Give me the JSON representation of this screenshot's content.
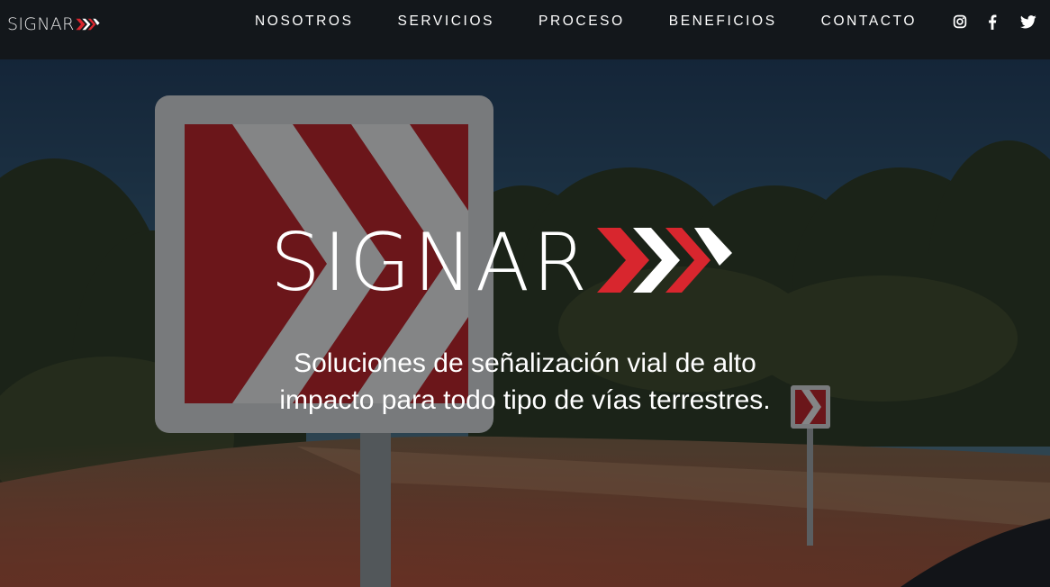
{
  "brand": {
    "name": "SIGNAR",
    "icon": "chevron-arrows-logo-icon",
    "colors": {
      "red": "#d8262e",
      "white": "#ffffff"
    }
  },
  "nav": {
    "items": [
      {
        "label": "NOSOTROS"
      },
      {
        "label": "SERVICIOS"
      },
      {
        "label": "PROCESO"
      },
      {
        "label": "BENEFICIOS"
      },
      {
        "label": "CONTACTO"
      }
    ]
  },
  "social": {
    "icons": [
      "instagram-icon",
      "facebook-icon",
      "twitter-icon"
    ]
  },
  "hero": {
    "title": "SIGNAR",
    "tagline_line1": "Soluciones de señalización vial de alto",
    "tagline_line2": "impacto para todo tipo de vías terrestres.",
    "background": "road-chevron-sign-photo"
  },
  "theme": {
    "nav_bg": "#13171b",
    "text": "#ffffff"
  }
}
